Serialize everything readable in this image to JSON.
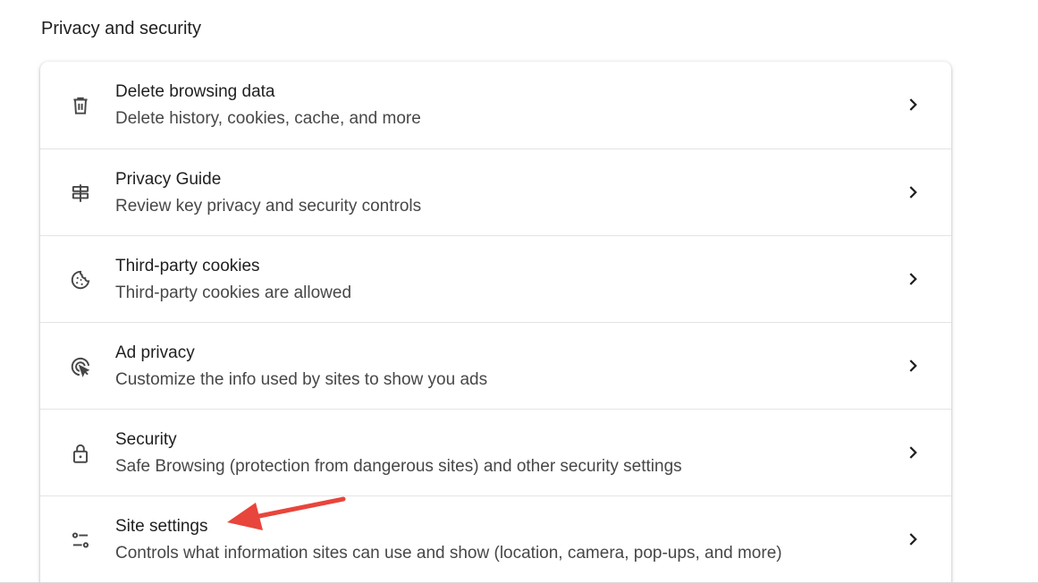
{
  "section": {
    "title": "Privacy and security"
  },
  "items": [
    {
      "title": "Delete browsing data",
      "subtitle": "Delete history, cookies, cache, and more",
      "icon": "trash-icon"
    },
    {
      "title": "Privacy Guide",
      "subtitle": "Review key privacy and security controls",
      "icon": "signpost-icon"
    },
    {
      "title": "Third-party cookies",
      "subtitle": "Third-party cookies are allowed",
      "icon": "cookie-icon"
    },
    {
      "title": "Ad privacy",
      "subtitle": "Customize the info used by sites to show you ads",
      "icon": "ad-privacy-icon"
    },
    {
      "title": "Security",
      "subtitle": "Safe Browsing (protection from dangerous sites) and other security settings",
      "icon": "lock-icon"
    },
    {
      "title": "Site settings",
      "subtitle": "Controls what information sites can use and show (location, camera, pop-ups, and more)",
      "icon": "tune-icon"
    }
  ],
  "annotation": {
    "icon": "red-arrow-icon",
    "color": "#e8453c"
  },
  "colors": {
    "text_primary": "#1f1f1f",
    "text_secondary": "#474747",
    "icon": "#474747",
    "divider": "#e4e4e4"
  }
}
